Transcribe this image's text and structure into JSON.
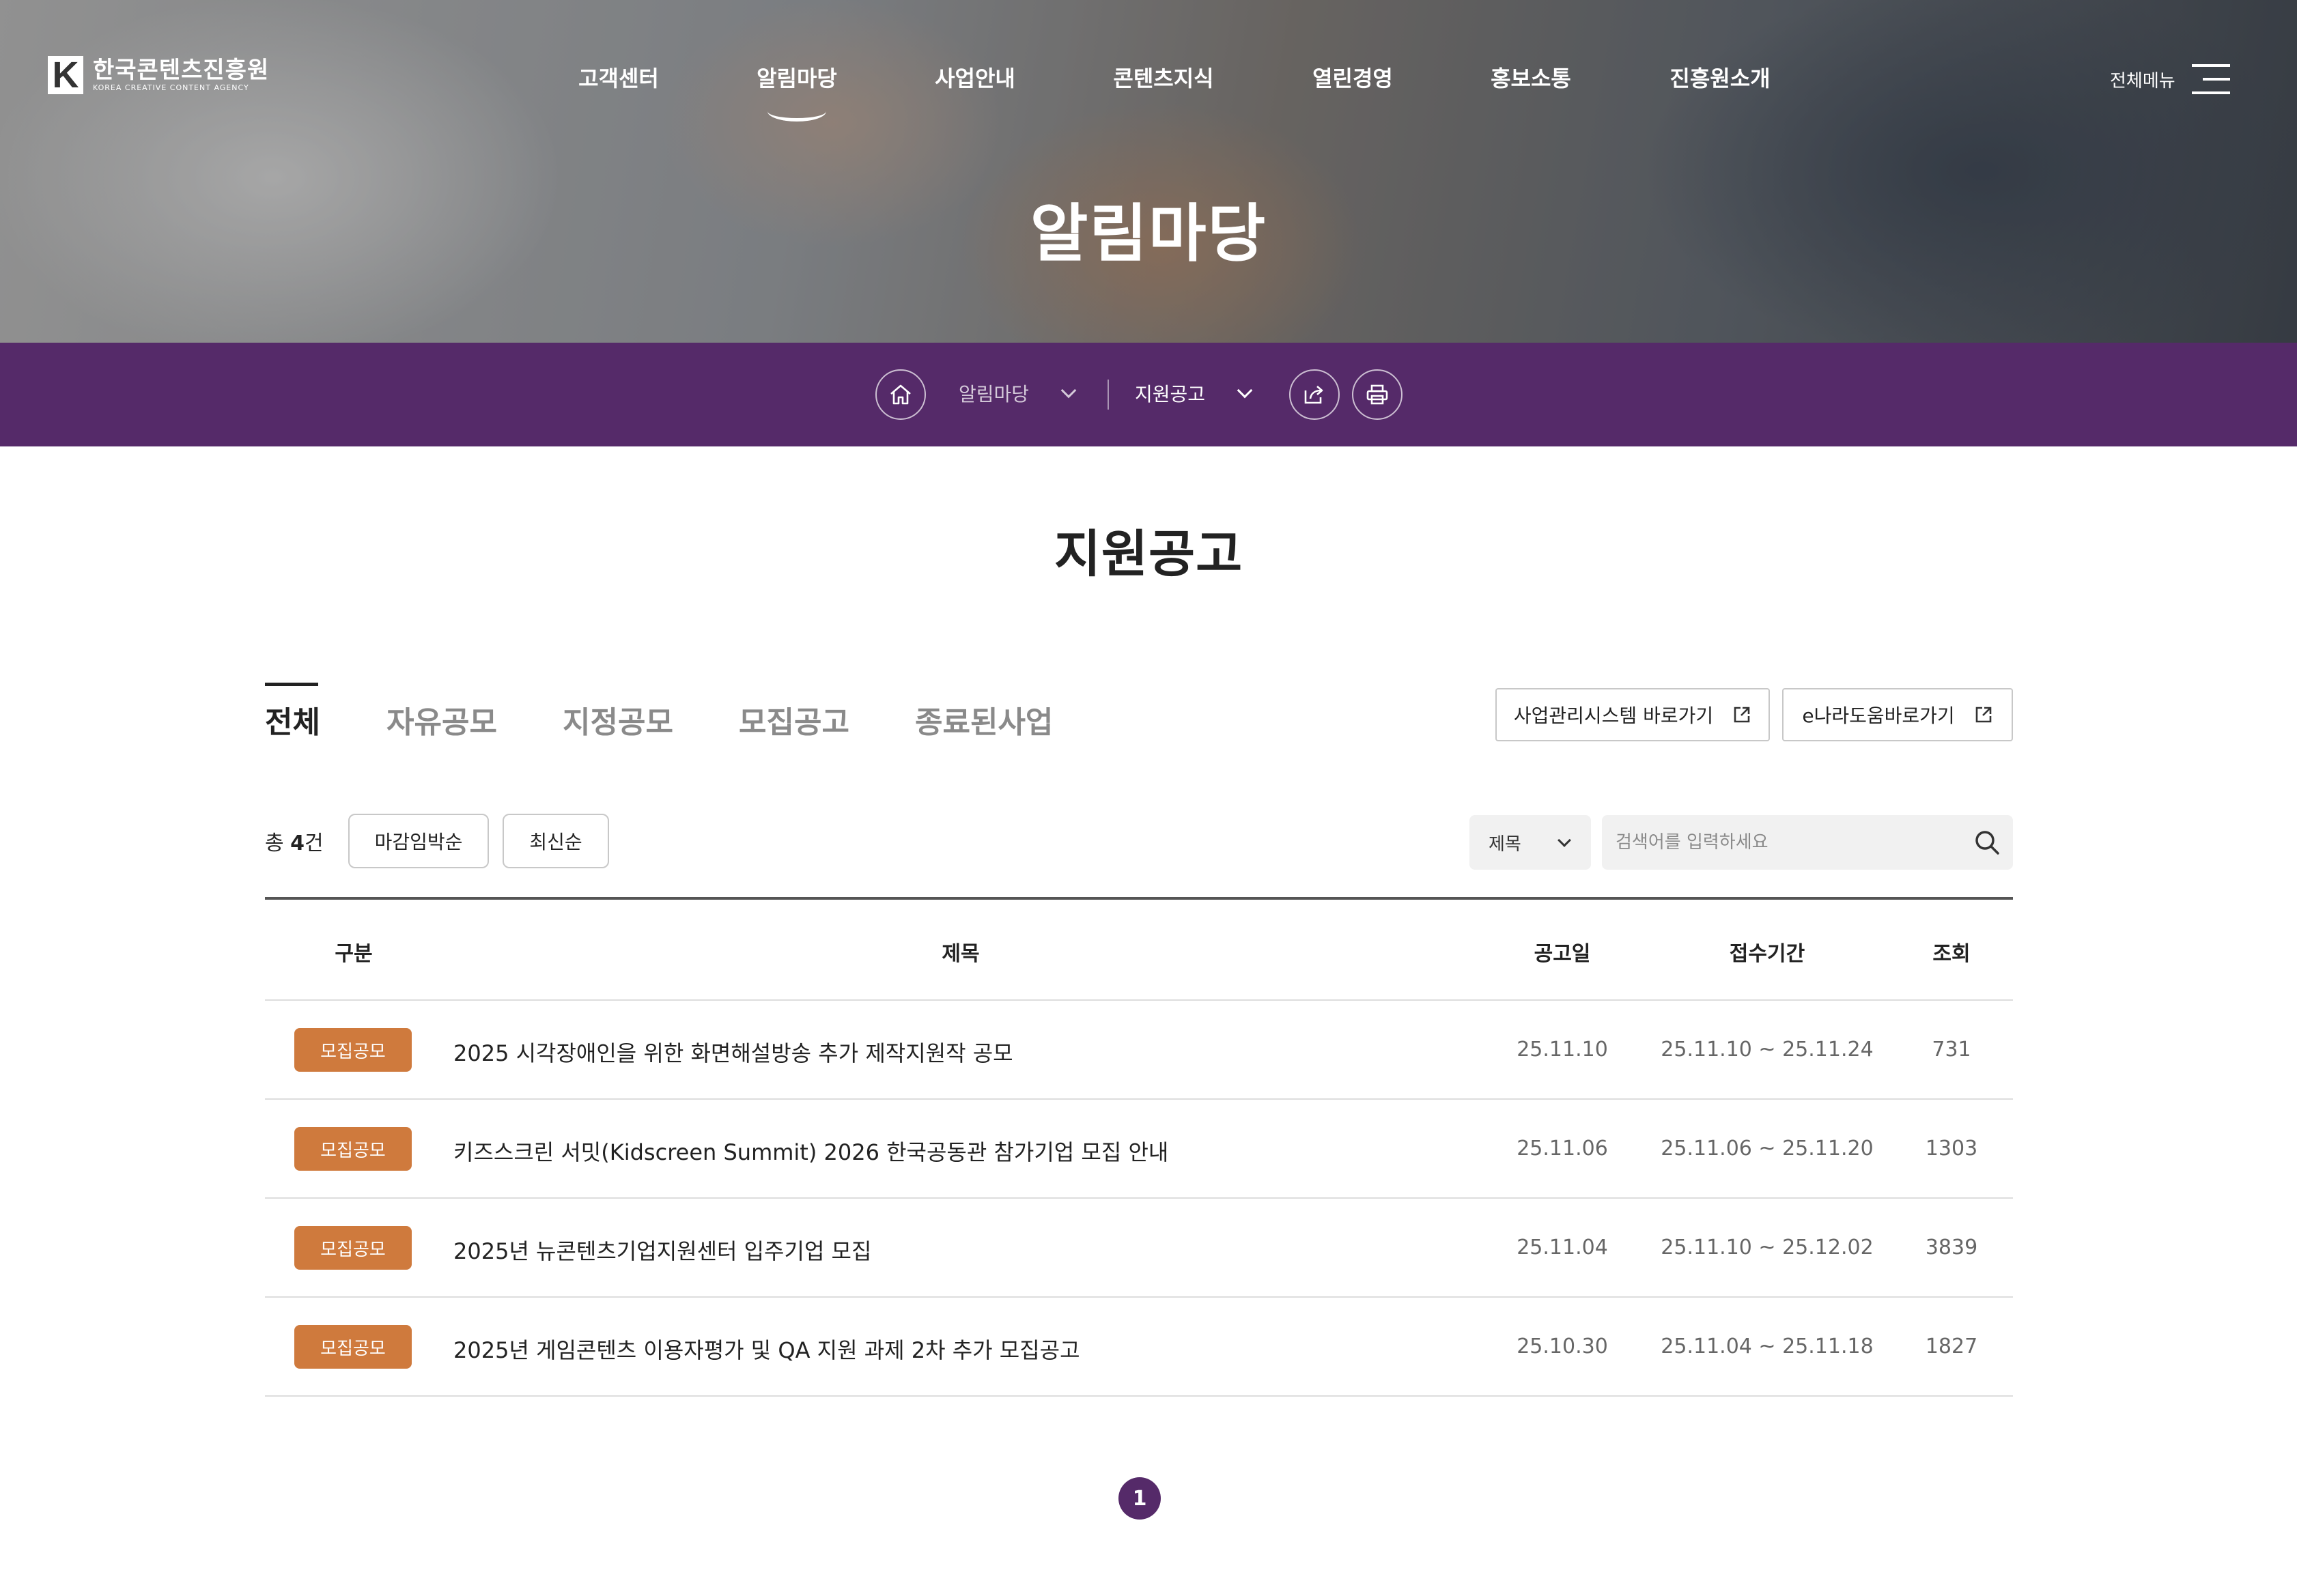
{
  "header": {
    "logo_kr": "한국콘텐츠진흥원",
    "logo_en": "KOREA CREATIVE CONTENT AGENCY",
    "logo_mark": "K",
    "nav": [
      "고객센터",
      "알림마당",
      "사업안내",
      "콘텐츠지식",
      "열린경영",
      "홍보소통",
      "진흥원소개"
    ],
    "active_nav": "알림마당",
    "all_menu_label": "전체메뉴"
  },
  "hero": {
    "title": "알림마당"
  },
  "location": {
    "depth1": "알림마당",
    "depth2": "지원공고",
    "icons": [
      "home-icon",
      "share-icon",
      "print-icon"
    ]
  },
  "page_title": "지원공고",
  "tabs": [
    "전체",
    "자유공모",
    "지정공모",
    "모집공고",
    "종료된사업"
  ],
  "active_tab": "전체",
  "external_links": [
    "사업관리시스템 바로가기",
    "e나라도움바로가기"
  ],
  "list_info": {
    "count_prefix": "총 ",
    "count": "4",
    "count_suffix": "건"
  },
  "sort": [
    "마감임박순",
    "최신순"
  ],
  "search": {
    "field": "제목",
    "placeholder": "검색어를 입력하세요"
  },
  "table": {
    "headers": [
      "구분",
      "제목",
      "공고일",
      "접수기간",
      "조회"
    ],
    "rows": [
      {
        "category": "모집공모",
        "title": "2025 시각장애인을 위한 화면해설방송 추가 제작지원작 공모",
        "date": "25.11.10",
        "period": "25.11.10 ~ 25.11.24",
        "views": "731"
      },
      {
        "category": "모집공모",
        "title": "키즈스크린 서밋(Kidscreen Summit) 2026 한국공동관 참가기업 모집 안내",
        "date": "25.11.06",
        "period": "25.11.06 ~ 25.11.20",
        "views": "1303"
      },
      {
        "category": "모집공모",
        "title": "2025년 뉴콘텐츠기업지원센터 입주기업 모집",
        "date": "25.11.04",
        "period": "25.11.10 ~ 25.12.02",
        "views": "3839"
      },
      {
        "category": "모집공모",
        "title": "2025년 게임콘텐츠 이용자평가 및 QA 지원 과제 2차 추가 모집공고",
        "date": "25.10.30",
        "period": "25.11.04 ~ 25.11.18",
        "views": "1827"
      }
    ]
  },
  "pagination": {
    "current": "1"
  },
  "colors": {
    "brand_purple": "#552a69",
    "badge_orange": "#cf7a3d"
  }
}
